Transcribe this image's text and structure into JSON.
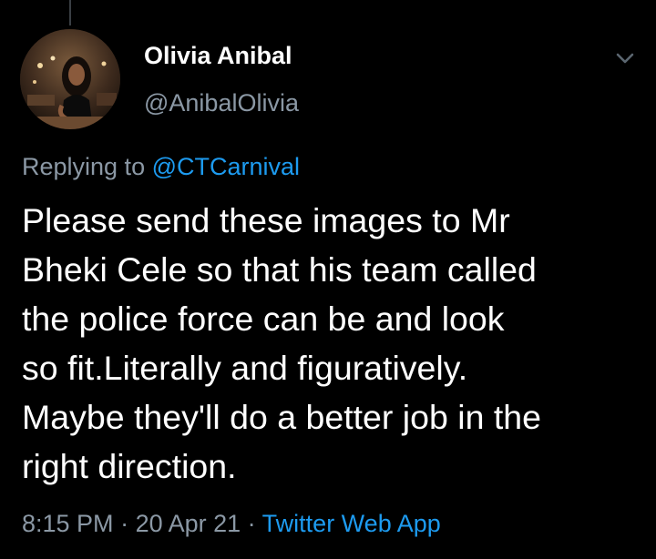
{
  "tweet": {
    "author": {
      "display_name": "Olivia Anibal",
      "handle": "@AnibalOlivia"
    },
    "reply": {
      "prefix": "Replying to ",
      "to_user": "@CTCarnival"
    },
    "text": "Please send these images to Mr\nBheki Cele so that his team called\nthe police force can be and look\nso fit.Literally and figuratively.\nMaybe they'll do a better job in the\nright direction.",
    "time": "8:15 PM",
    "date": "20 Apr 21",
    "separator": " · ",
    "source": "Twitter Web App"
  },
  "icons": {
    "menu": "chevron-down-icon",
    "avatar": "profile-photo"
  },
  "colors": {
    "background": "#000000",
    "primary_text": "#ffffff",
    "secondary_text": "#8b98a5",
    "accent": "#1d9bf0"
  }
}
